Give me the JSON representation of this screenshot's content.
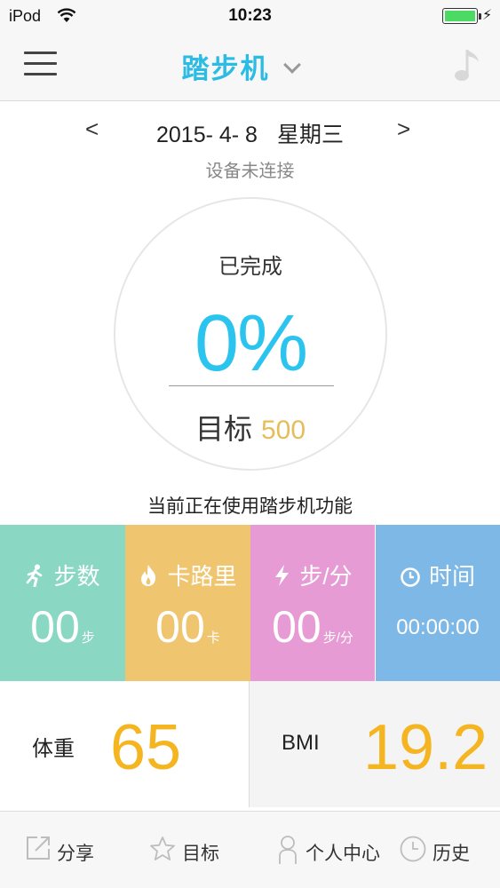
{
  "status_bar": {
    "carrier": "iPod",
    "time": "10:23"
  },
  "nav": {
    "title": "踏步机",
    "icons": [
      "menu-icon",
      "chevron-down-icon",
      "music-note-icon"
    ]
  },
  "date": {
    "prev": "<",
    "next": ">",
    "date": "2015- 4- 8",
    "weekday": "星期三",
    "device_status": "设备未连接"
  },
  "progress": {
    "label": "已完成",
    "percent": "0%",
    "goal_label": "目标",
    "goal_value": "500"
  },
  "mode_text": "当前正在使用踏步机功能",
  "tiles": [
    {
      "label": "步数",
      "value": "00",
      "unit": "步",
      "icon": "runner-icon",
      "color": "#8ad8c3"
    },
    {
      "label": "卡路里",
      "value": "00",
      "unit": "卡",
      "icon": "flame-icon",
      "color": "#efc570"
    },
    {
      "label": "步/分",
      "value": "00",
      "unit": "步/分",
      "icon": "lightning-icon",
      "color": "#e79bd5"
    },
    {
      "label": "时间",
      "value": "00:00:00",
      "icon": "clock-icon",
      "color": "#7eb8e6"
    }
  ],
  "metrics": {
    "weight_label": "体重",
    "weight_value": "65",
    "bmi_label": "BMI",
    "bmi_value": "19.2",
    "value_color": "#f4b521"
  },
  "bottom_bar": {
    "items": [
      {
        "label": "分享",
        "icon": "share-icon"
      },
      {
        "label": "目标",
        "icon": "star-icon"
      },
      {
        "label": "个人中心",
        "icon": "person-icon"
      },
      {
        "label": "历史",
        "icon": "clock-icon"
      }
    ]
  },
  "colors": {
    "accent": "#2bc4ef",
    "goal": "#e5bd5a"
  }
}
